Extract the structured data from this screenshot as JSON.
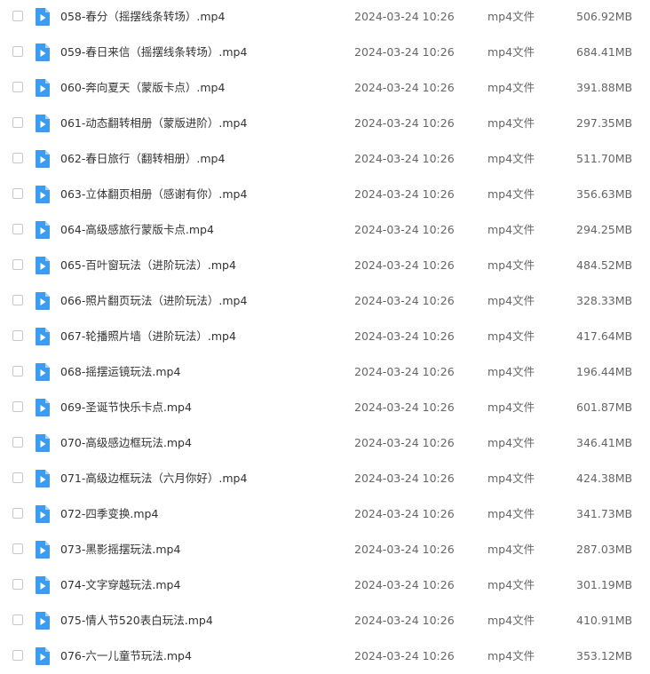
{
  "colors": {
    "icon_blue": "#3d9bf2",
    "icon_fold": "#a9d2fa",
    "checkbox_border": "#c9c9c9"
  },
  "file_icon": "video-file-icon",
  "files": [
    {
      "name": "058-春分（摇摆线条转场）.mp4",
      "date": "2024-03-24 10:26",
      "type": "mp4文件",
      "size": "506.92MB"
    },
    {
      "name": "059-春日来信（摇摆线条转场）.mp4",
      "date": "2024-03-24 10:26",
      "type": "mp4文件",
      "size": "684.41MB"
    },
    {
      "name": "060-奔向夏天（蒙版卡点）.mp4",
      "date": "2024-03-24 10:26",
      "type": "mp4文件",
      "size": "391.88MB"
    },
    {
      "name": "061-动态翻转相册（蒙版进阶）.mp4",
      "date": "2024-03-24 10:26",
      "type": "mp4文件",
      "size": "297.35MB"
    },
    {
      "name": "062-春日旅行（翻转相册）.mp4",
      "date": "2024-03-24 10:26",
      "type": "mp4文件",
      "size": "511.70MB"
    },
    {
      "name": "063-立体翻页相册（感谢有你）.mp4",
      "date": "2024-03-24 10:26",
      "type": "mp4文件",
      "size": "356.63MB"
    },
    {
      "name": "064-高级感旅行蒙版卡点.mp4",
      "date": "2024-03-24 10:26",
      "type": "mp4文件",
      "size": "294.25MB"
    },
    {
      "name": "065-百叶窗玩法（进阶玩法）.mp4",
      "date": "2024-03-24 10:26",
      "type": "mp4文件",
      "size": "484.52MB"
    },
    {
      "name": "066-照片翻页玩法（进阶玩法）.mp4",
      "date": "2024-03-24 10:26",
      "type": "mp4文件",
      "size": "328.33MB"
    },
    {
      "name": "067-轮播照片墙（进阶玩法）.mp4",
      "date": "2024-03-24 10:26",
      "type": "mp4文件",
      "size": "417.64MB"
    },
    {
      "name": "068-摇摆运镜玩法.mp4",
      "date": "2024-03-24 10:26",
      "type": "mp4文件",
      "size": "196.44MB"
    },
    {
      "name": "069-圣诞节快乐卡点.mp4",
      "date": "2024-03-24 10:26",
      "type": "mp4文件",
      "size": "601.87MB"
    },
    {
      "name": "070-高级感边框玩法.mp4",
      "date": "2024-03-24 10:26",
      "type": "mp4文件",
      "size": "346.41MB"
    },
    {
      "name": "071-高级边框玩法（六月你好）.mp4",
      "date": "2024-03-24 10:26",
      "type": "mp4文件",
      "size": "424.38MB"
    },
    {
      "name": "072-四季变换.mp4",
      "date": "2024-03-24 10:26",
      "type": "mp4文件",
      "size": "341.73MB"
    },
    {
      "name": "073-黑影摇摆玩法.mp4",
      "date": "2024-03-24 10:26",
      "type": "mp4文件",
      "size": "287.03MB"
    },
    {
      "name": "074-文字穿越玩法.mp4",
      "date": "2024-03-24 10:26",
      "type": "mp4文件",
      "size": "301.19MB"
    },
    {
      "name": "075-情人节520表白玩法.mp4",
      "date": "2024-03-24 10:26",
      "type": "mp4文件",
      "size": "410.91MB"
    },
    {
      "name": "076-六一儿童节玩法.mp4",
      "date": "2024-03-24 10:26",
      "type": "mp4文件",
      "size": "353.12MB"
    }
  ]
}
